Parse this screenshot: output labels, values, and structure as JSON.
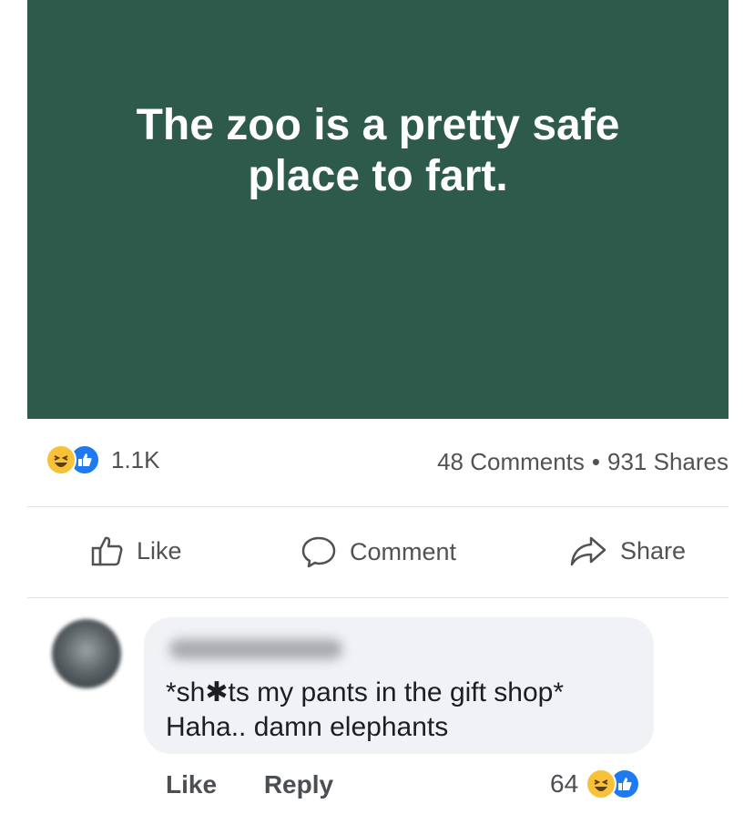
{
  "post": {
    "image_text": "The zoo is a pretty safe place to fart.",
    "image_bg": "#2d5a4b"
  },
  "stats": {
    "reaction_count": "1.1K",
    "comments": "48 Comments",
    "shares": "931 Shares",
    "separator": "•"
  },
  "actions": {
    "like": "Like",
    "comment": "Comment",
    "share": "Share"
  },
  "comment": {
    "line1": "*sh✱ts my pants in the gift shop*",
    "line2": "Haha.. damn elephants",
    "like": "Like",
    "reply": "Reply",
    "reaction_count": "64"
  },
  "colors": {
    "accent_like": "#1f7af0",
    "haha": "#f7c23a"
  }
}
